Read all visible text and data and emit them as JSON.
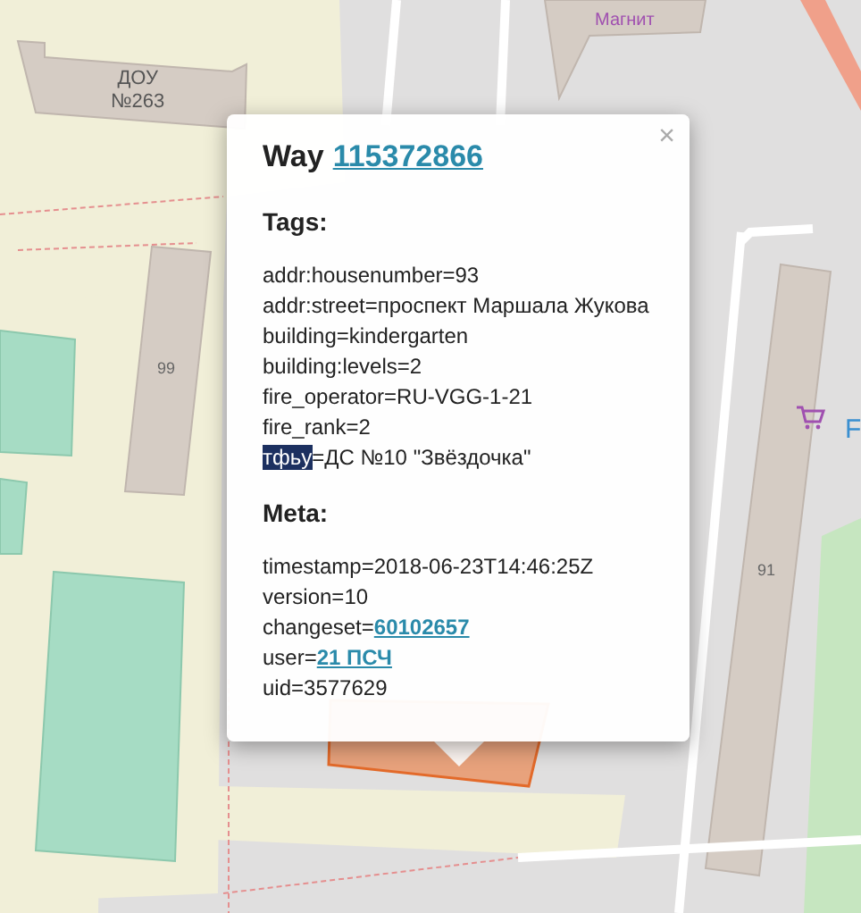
{
  "map": {
    "labels": [
      {
        "text": "ДОУ\n№263",
        "kind": "building"
      },
      {
        "text": "Магнит",
        "kind": "shop"
      },
      {
        "text": "99",
        "kind": "housenumber"
      },
      {
        "text": "91",
        "kind": "housenumber"
      },
      {
        "text": "F",
        "kind": "poi"
      }
    ]
  },
  "popup": {
    "type_label": "Way",
    "id": "115372866",
    "close": "×",
    "tags_heading": "Tags:",
    "tags": [
      {
        "key": "addr:housenumber",
        "value": "=93",
        "selected": false
      },
      {
        "key": "addr:street",
        "value": "=проспект Маршала Жукова",
        "selected": false
      },
      {
        "key": "building",
        "value": "=kindergarten",
        "selected": false
      },
      {
        "key": "building:levels",
        "value": "=2",
        "selected": false
      },
      {
        "key": "fire_operator",
        "value": "=RU-VGG-1-21",
        "selected": false
      },
      {
        "key": "fire_rank",
        "value": "=2",
        "selected": false
      },
      {
        "key": "тфьу",
        "value": "=ДС №10 \"Звёздочка\"",
        "selected": true
      }
    ],
    "meta_heading": "Meta:",
    "meta": [
      {
        "key": "timestamp=",
        "value": "2018-06-23T14:46:25Z",
        "kind": "text"
      },
      {
        "key": "version=",
        "value": "10",
        "kind": "text"
      },
      {
        "key": "changeset=",
        "value": "60102657",
        "kind": "link"
      },
      {
        "key": "user=",
        "value": "21 ПСЧ",
        "kind": "link"
      },
      {
        "key": "uid=",
        "value": "3577629",
        "kind": "text"
      }
    ]
  }
}
